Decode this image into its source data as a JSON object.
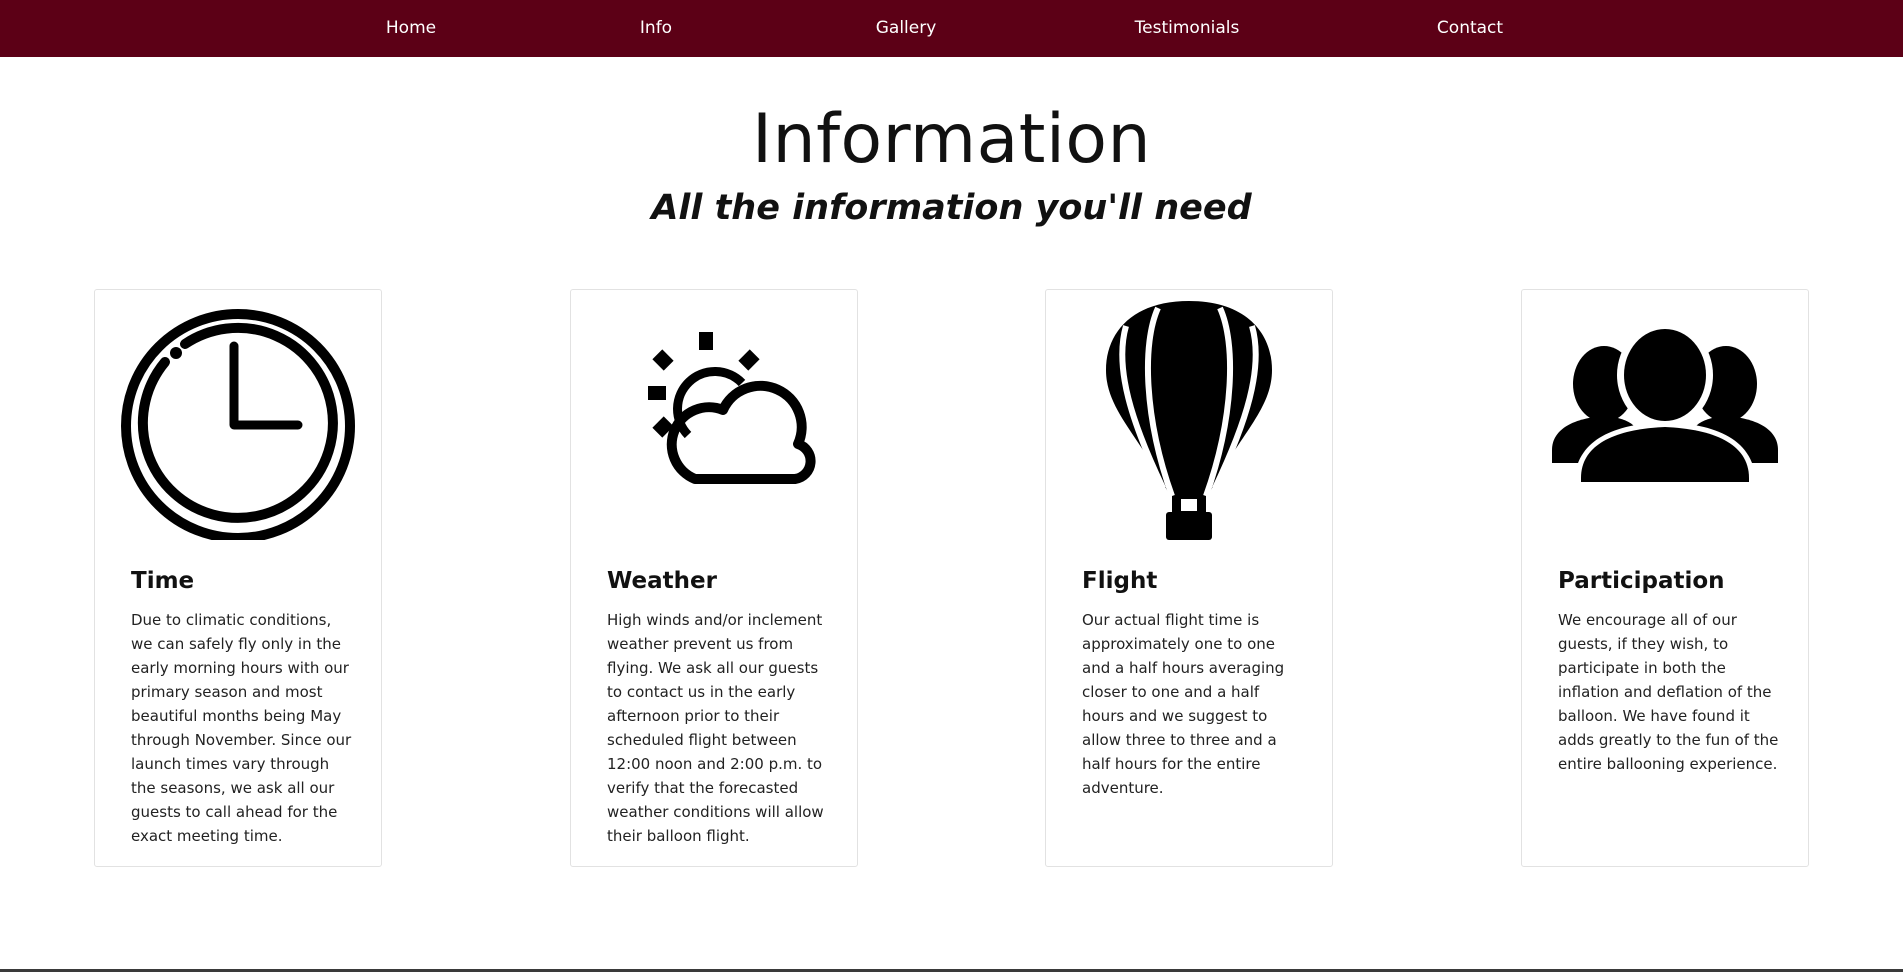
{
  "nav": {
    "items": [
      {
        "label": "Home"
      },
      {
        "label": "Info"
      },
      {
        "label": "Gallery"
      },
      {
        "label": "Testimonials"
      },
      {
        "label": "Contact"
      }
    ]
  },
  "header": {
    "title": "Information",
    "subtitle": "All the information you'll need"
  },
  "cards": [
    {
      "icon": "clock-icon",
      "title": "Time",
      "text": "Due to climatic conditions, we can safely fly only in the early morning hours with our primary season and most beautiful months being May through November. Since our launch times vary through the seasons, we ask all our guests to call ahead for the exact meeting time."
    },
    {
      "icon": "sun-cloud-icon",
      "title": "Weather",
      "text": "High winds and/or inclement weather prevent us from flying. We ask all our guests to contact us in the early afternoon prior to their scheduled flight between 12:00 noon and 2:00 p.m. to verify that the forecasted weather conditions will allow their balloon flight."
    },
    {
      "icon": "hot-air-balloon-icon",
      "title": "Flight",
      "text": "Our actual flight time is approximately one to one and a half hours averaging closer to one and a half hours and we suggest to allow three to three and a half hours for the entire adventure."
    },
    {
      "icon": "group-people-icon",
      "title": "Participation",
      "text": "We encourage all of our guests, if they wish, to participate in both the inflation and deflation of the balloon. We have found it adds greatly to the fun of the entire ballooning experience."
    }
  ],
  "colors": {
    "nav_background": "#5c0016",
    "nav_text": "#ffffff",
    "icon": "#000000"
  }
}
